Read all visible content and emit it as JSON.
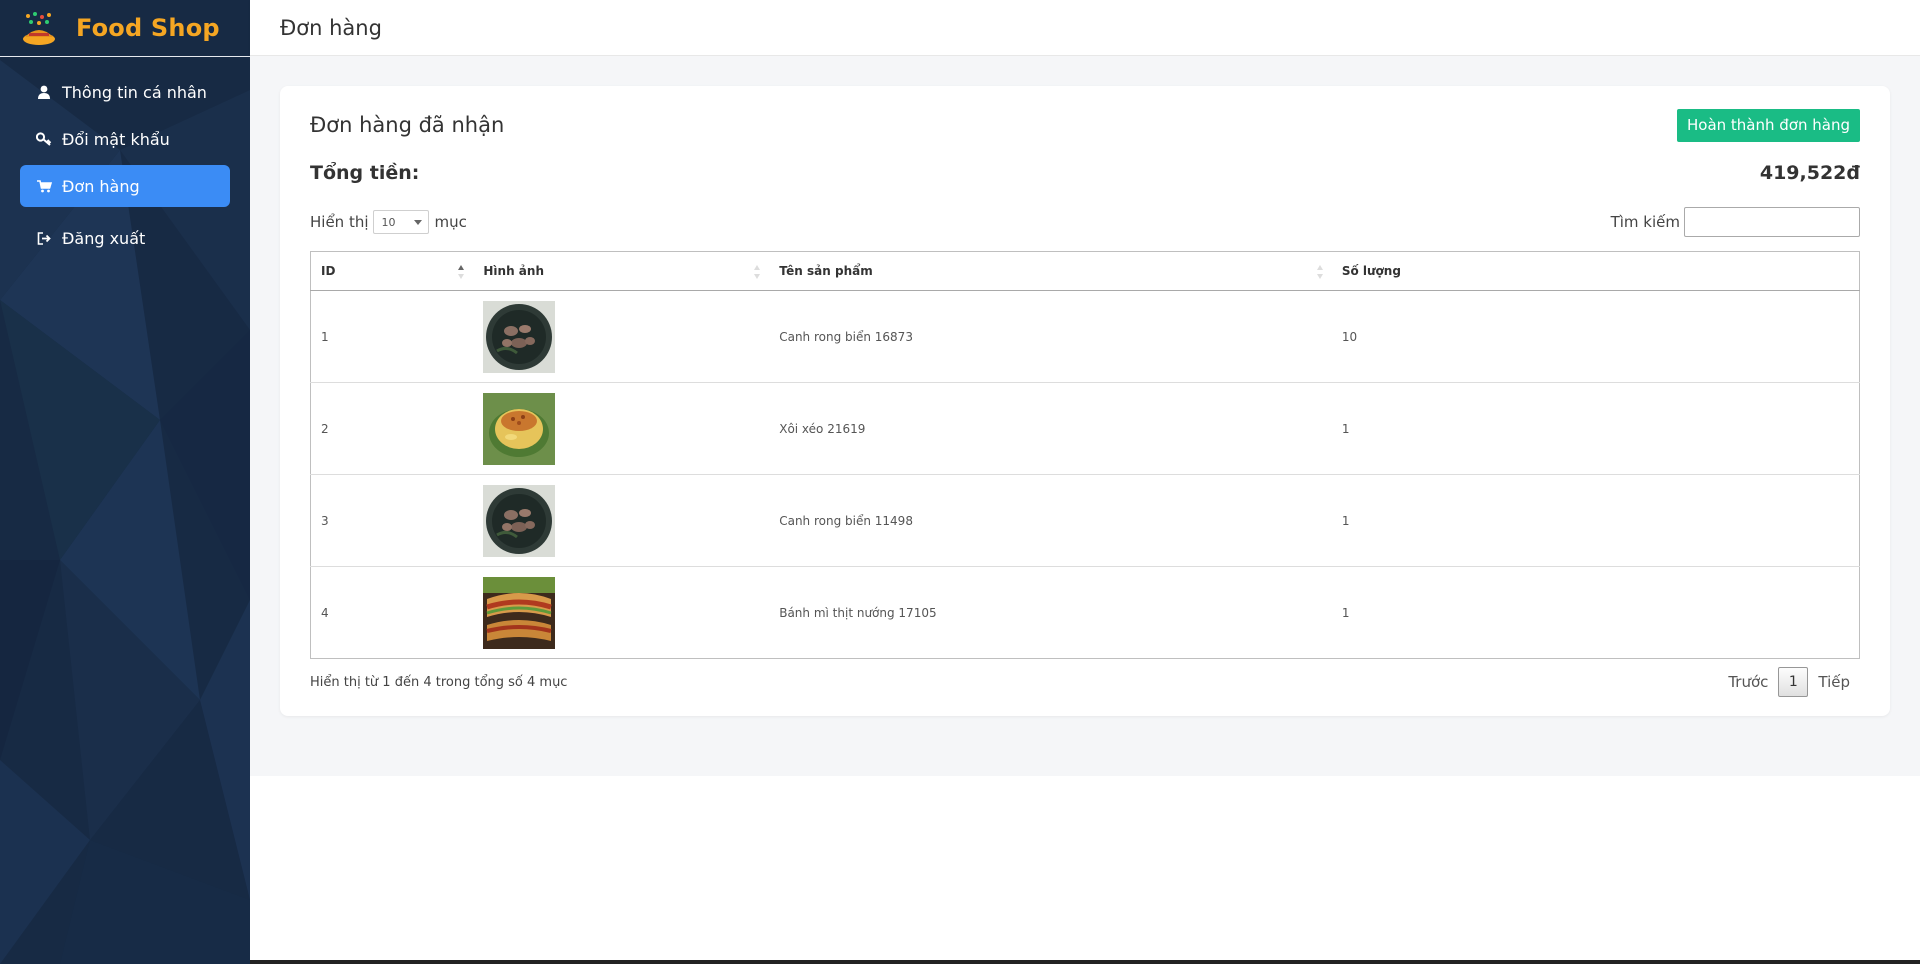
{
  "app": {
    "name": "Food Shop"
  },
  "sidebar": {
    "items": [
      {
        "label": "Thông tin cá nhân",
        "icon": "user-icon"
      },
      {
        "label": "Đổi mật khẩu",
        "icon": "key-icon"
      },
      {
        "label": "Đơn hàng",
        "icon": "cart-icon",
        "active": true
      },
      {
        "label": "Đăng xuất",
        "icon": "logout-icon"
      }
    ]
  },
  "header": {
    "title": "Đơn hàng"
  },
  "card": {
    "title": "Đơn hàng đã nhận",
    "complete_button": "Hoàn thành đơn hàng",
    "total_label": "Tổng tiền:",
    "total_value": "419,522đ"
  },
  "table_controls": {
    "show_label": "Hiển thị",
    "page_length": "10",
    "entries_label": "mục",
    "search_label": "Tìm kiếm",
    "search_value": ""
  },
  "table": {
    "columns": [
      "ID",
      "Hình ảnh",
      "Tên sản phẩm",
      "Số lượng"
    ],
    "rows": [
      {
        "id": "1",
        "image": "seaweed-soup-photo",
        "name": "Canh rong biển 16873",
        "qty": "10"
      },
      {
        "id": "2",
        "image": "xoi-xeo-photo",
        "name": "Xôi xéo 21619",
        "qty": "1"
      },
      {
        "id": "3",
        "image": "seaweed-soup-photo",
        "name": "Canh rong biển 11498",
        "qty": "1"
      },
      {
        "id": "4",
        "image": "banh-mi-photo",
        "name": "Bánh mì thịt nướng 17105",
        "qty": "1"
      }
    ]
  },
  "footer": {
    "info": "Hiển thị từ 1 đến 4 trong tổng số 4 mục",
    "prev": "Trước",
    "current_page": "1",
    "next": "Tiếp"
  },
  "colors": {
    "sidebar_bg": "#172a44",
    "brand": "#f5a623",
    "active_item": "#3b8cf5",
    "complete_button": "#1abc85"
  }
}
